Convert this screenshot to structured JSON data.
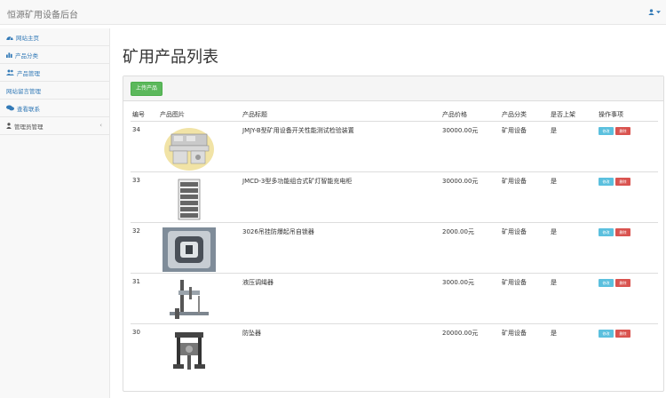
{
  "app": {
    "title": "恒源矿用设备后台"
  },
  "sidebar": {
    "items": [
      {
        "label": "网站主页",
        "icon": "dashboard-icon"
      },
      {
        "label": "产品分类",
        "icon": "bar-chart-icon"
      },
      {
        "label": "产品管理",
        "icon": "users-icon"
      },
      {
        "label": "网站留言管理",
        "icon": "none"
      },
      {
        "label": "查看联系",
        "icon": "comments-icon"
      },
      {
        "label": "管理员管理",
        "icon": "user-icon",
        "chevron": "‹"
      }
    ]
  },
  "main": {
    "title": "矿用产品列表",
    "add_button": "上传产品",
    "table": {
      "headers": [
        "编号",
        "产品图片",
        "产品标题",
        "产品价格",
        "产品分类",
        "是否上架",
        "操作事项"
      ],
      "rows": [
        {
          "id": "34",
          "image": "test-bench-image",
          "name": "JMJY-B型矿用设备开关性能测试检验装置",
          "price": "30000.00元",
          "category": "矿用设备",
          "listed": "是",
          "edit": "修改",
          "delete": "删除"
        },
        {
          "id": "33",
          "image": "charging-rack-image",
          "name": "JMCD-3型多功能组合式矿灯智能充电柜",
          "price": "30000.00元",
          "category": "矿用设备",
          "listed": "是",
          "edit": "修改",
          "delete": "删除"
        },
        {
          "id": "32",
          "image": "wire-clamp-image",
          "name": "3026吊挂防爆起吊自锁器",
          "price": "2000.00元",
          "category": "矿用设备",
          "listed": "是",
          "edit": "修改",
          "delete": "删除"
        },
        {
          "id": "31",
          "image": "pipe-support-image",
          "name": "液压调绳器",
          "price": "3000.00元",
          "category": "矿用设备",
          "listed": "是",
          "edit": "修改",
          "delete": "删除"
        },
        {
          "id": "30",
          "image": "anti-fall-device-image",
          "name": "防坠器",
          "price": "20000.00元",
          "category": "矿用设备",
          "listed": "是",
          "edit": "修改",
          "delete": "删除"
        }
      ]
    }
  },
  "colors": {
    "link": "#337ab7",
    "success": "#5cb85c",
    "info": "#5bc0de",
    "danger": "#d9534f"
  }
}
